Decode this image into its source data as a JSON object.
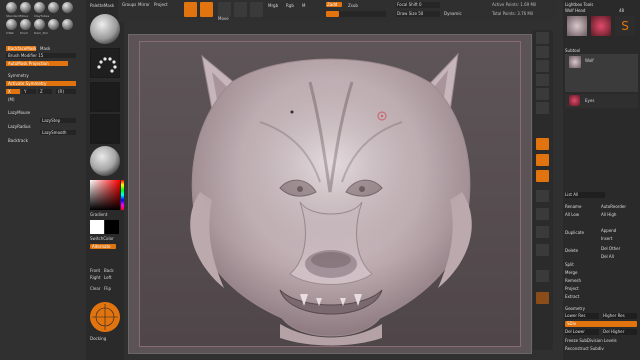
{
  "app": {
    "accent": "#e2740f",
    "window_title": "ZBrush"
  },
  "brushes": [
    {
      "label": "Standard"
    },
    {
      "label": "Move"
    },
    {
      "label": "ClayTubes"
    },
    {
      "label": "Inflat"
    },
    {
      "label": "Pinch"
    },
    {
      "label": "Dam_Std"
    }
  ],
  "left_panel": {
    "stroke_label": "BackfaceMask",
    "stroke_toggle": "Mask",
    "brush_modifier": "Brush Modifier 15",
    "backface_prop": "AutoMask Projection",
    "symmetry_header": "Symmetry",
    "activate_symmetry": "Activate Symmetry",
    "axis_x": "X",
    "axis_y": "Y",
    "axis_z": "Z",
    "m_label": "(M)",
    "radial_label": "(R)",
    "lazy_header": "LazyMouse",
    "lazystep": "LazyStep",
    "lazyradius": "LazyRadius",
    "lazy_smooth": "LazySmooth",
    "backtrack": "Backtrack"
  },
  "tool_column": {
    "header": "PaletteMask",
    "alpha_label": "Alpha",
    "texture_label": "Texture",
    "material_label": "Material",
    "gradient_label": "Gradient",
    "switch_color": "SwitchColor",
    "alternate": "Alternate",
    "front": "Front",
    "back": "Back",
    "right": "Right",
    "left": "Left",
    "clear": "Clear",
    "flip": "Flip",
    "dock_label": "Docking"
  },
  "top_bar": {
    "groups_label": "Groups",
    "mirror_label": "Mirror",
    "project_label": "Project",
    "draw_label": "Draw",
    "move_label": "Move",
    "scale_label": "Scale",
    "rotate_label": "Rotate",
    "mrgb_label": "Mrgb",
    "rgb_label": "Rgb",
    "m_label": "M",
    "zadd_label": "Zadd",
    "zsub_label": "Zsub",
    "focal_shift": "Focal Shift 0",
    "draw_size": "Draw Size 50",
    "dynamic": "Dynamic",
    "active_points": "Active Points: 1.69 Mil",
    "total_points": "Total Points: 3.76 Mil",
    "rgb_intensity": "Rgb Intensity 100",
    "z_intensity": "Z Intensity 25"
  },
  "right_shelf": [
    {
      "label": "BPR"
    },
    {
      "label": "SPix 3"
    },
    {
      "label": "Scroll"
    },
    {
      "label": "Zoom"
    },
    {
      "label": "Actual"
    },
    {
      "label": "AAHalf"
    },
    {
      "label": "Persp"
    },
    {
      "label": "Floor"
    },
    {
      "label": "Local"
    },
    {
      "label": "L.Sym"
    },
    {
      "label": "Frame"
    },
    {
      "label": "Move"
    },
    {
      "label": "Scale"
    },
    {
      "label": "Rotate"
    },
    {
      "label": "Transp"
    }
  ],
  "right_panel": {
    "header": "Lightbox Tools",
    "tool_name": "Wolf Head",
    "tool_count": "48",
    "subtool_header": "Subtool",
    "subtool_1": "Wolf",
    "subtool_2": "Eyes",
    "list_all": "List All",
    "rename": "Rename",
    "auto_reorder": "AutoReorder",
    "all_low": "All Low",
    "all_high": "All High",
    "duplicate": "Duplicate",
    "append": "Append",
    "insert": "Insert",
    "delete": "Delete",
    "del_other": "Del Other",
    "del_all": "Del All",
    "split": "Split",
    "merge": "Merge",
    "remesh": "Remesh",
    "project": "Project",
    "extract": "Extract",
    "geometry_header": "Geometry",
    "lower_res": "Lower Res",
    "higher_res": "Higher Res",
    "sdiv": "SDiv",
    "del_lower": "Del Lower",
    "del_higher": "Del Higher",
    "freeze": "Freeze SubDivision Levels",
    "reconstruct": "Reconstruct Subdiv"
  }
}
